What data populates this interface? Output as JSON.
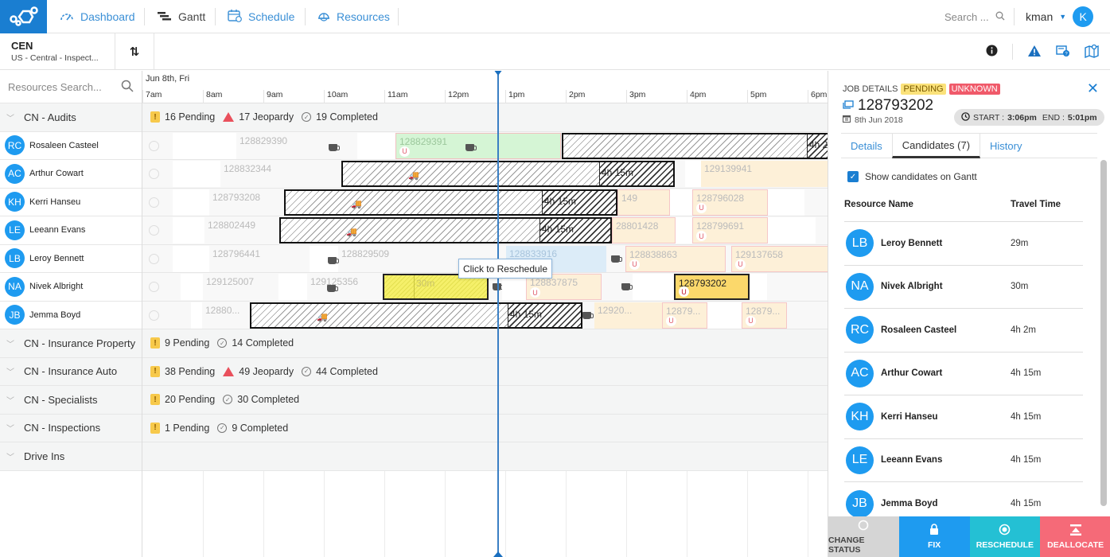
{
  "nav": {
    "items": [
      {
        "label": "Dashboard",
        "icon": "gauge-icon"
      },
      {
        "label": "Gantt",
        "icon": "gantt-icon"
      },
      {
        "label": "Schedule",
        "icon": "calendar-icon"
      },
      {
        "label": "Resources",
        "icon": "helmet-icon"
      }
    ],
    "search_placeholder": "Search ...",
    "user_name": "kman",
    "user_initial": "K"
  },
  "region": {
    "code": "CEN",
    "name": "US - Central - Inspect..."
  },
  "resources_search_placeholder": "Resources Search...",
  "gantt": {
    "date": "Jun 8th, Fri",
    "hours": [
      "7am",
      "8am",
      "9am",
      "10am",
      "11am",
      "12pm",
      "1pm",
      "2pm",
      "3pm",
      "4pm",
      "5pm",
      "6pm"
    ],
    "tooltip": "Click to Reschedule"
  },
  "groups": [
    {
      "name": "CN - Audits",
      "pending": "16 Pending",
      "jeopardy": "17 Jeopardy",
      "completed": "19 Completed",
      "resources": [
        {
          "initials": "RC",
          "name": "Rosaleen Casteel"
        },
        {
          "initials": "AC",
          "name": "Arthur Cowart"
        },
        {
          "initials": "KH",
          "name": "Kerri Hanseu"
        },
        {
          "initials": "LE",
          "name": "Leeann Evans"
        },
        {
          "initials": "LB",
          "name": "Leroy Bennett"
        },
        {
          "initials": "NA",
          "name": "Nivek Albright"
        },
        {
          "initials": "JB",
          "name": "Jemma Boyd"
        }
      ]
    },
    {
      "name": "CN - Insurance Property",
      "pending": "9 Pending",
      "jeopardy": null,
      "completed": "14 Completed"
    },
    {
      "name": "CN - Insurance Auto",
      "pending": "38 Pending",
      "jeopardy": "49 Jeopardy",
      "completed": "44 Completed"
    },
    {
      "name": "CN - Specialists",
      "pending": "20 Pending",
      "jeopardy": null,
      "completed": "30 Completed"
    },
    {
      "name": "CN - Inspections",
      "pending": "1 Pending",
      "jeopardy": null,
      "completed": "9 Completed"
    },
    {
      "name": "Drive Ins",
      "pending": null,
      "jeopardy": null,
      "completed": null
    }
  ],
  "jobs": {
    "r0": [
      "128829390",
      "128829391",
      "4h 2"
    ],
    "r1": [
      "128832344",
      "4h 15m",
      "129139941"
    ],
    "r2": [
      "128793208",
      "4h 15m",
      "149",
      "128796028"
    ],
    "r3": [
      "128802449",
      "4h 15m",
      "28801428",
      "128799691"
    ],
    "r4": [
      "128796441",
      "128829509",
      "128833916",
      "128838863",
      "129137658"
    ],
    "r5": [
      "129125007",
      "129125356",
      "30m",
      "128837875",
      "128793202"
    ],
    "r6": [
      "12880...",
      "4h 15m",
      "12920...",
      "12879...",
      "12879..."
    ],
    "unassigned_badge": "U"
  },
  "panel": {
    "label": "JOB DETAILS",
    "status": "PENDING",
    "priority": "UNKNOWN",
    "job_id": "128793202",
    "date": "8th Jun 2018",
    "start_label": "START :",
    "start": "3:06pm",
    "end_label": "END :",
    "end": "5:01pm",
    "tabs": [
      "Details",
      "Candidates (7)",
      "History"
    ],
    "show_candidates": "Show candidates on Gantt",
    "col_name": "Resource Name",
    "col_travel": "Travel Time",
    "candidates": [
      {
        "initials": "LB",
        "name": "Leroy Bennett",
        "travel": "29m"
      },
      {
        "initials": "NA",
        "name": "Nivek Albright",
        "travel": "30m"
      },
      {
        "initials": "RC",
        "name": "Rosaleen Casteel",
        "travel": "4h 2m"
      },
      {
        "initials": "AC",
        "name": "Arthur Cowart",
        "travel": "4h 15m"
      },
      {
        "initials": "KH",
        "name": "Kerri Hanseu",
        "travel": "4h 15m"
      },
      {
        "initials": "LE",
        "name": "Leeann Evans",
        "travel": "4h 15m"
      },
      {
        "initials": "JB",
        "name": "Jemma Boyd",
        "travel": "4h 15m"
      }
    ],
    "actions": [
      "CHANGE STATUS",
      "FIX",
      "RESCHEDULE",
      "DEALLOCATE"
    ]
  },
  "colors": {
    "brand": "#1a7ed1",
    "avatar": "#1e9bf0",
    "pending": "#fbe27a",
    "unknown": "#f05a6a",
    "reschedule": "#24c0d4",
    "deallocate": "#f56a78"
  }
}
